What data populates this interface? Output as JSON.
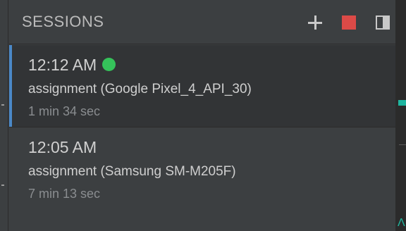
{
  "panel": {
    "title": "SESSIONS",
    "actions": {
      "add_icon": "plus-icon",
      "stop_icon": "stop-icon",
      "layout_icon": "layout-icon"
    }
  },
  "sessions": [
    {
      "time": "12:12 AM",
      "live": true,
      "name": "assignment (Google Pixel_4_API_30)",
      "duration": "1 min 34 sec",
      "selected": true
    },
    {
      "time": "12:05 AM",
      "live": false,
      "name": "assignment (Samsung SM-M205F)",
      "duration": "7 min 13 sec",
      "selected": false
    }
  ],
  "colors": {
    "accent_selection": "#4a88c7",
    "live_indicator": "#35c25a",
    "stop": "#dc4a47"
  }
}
